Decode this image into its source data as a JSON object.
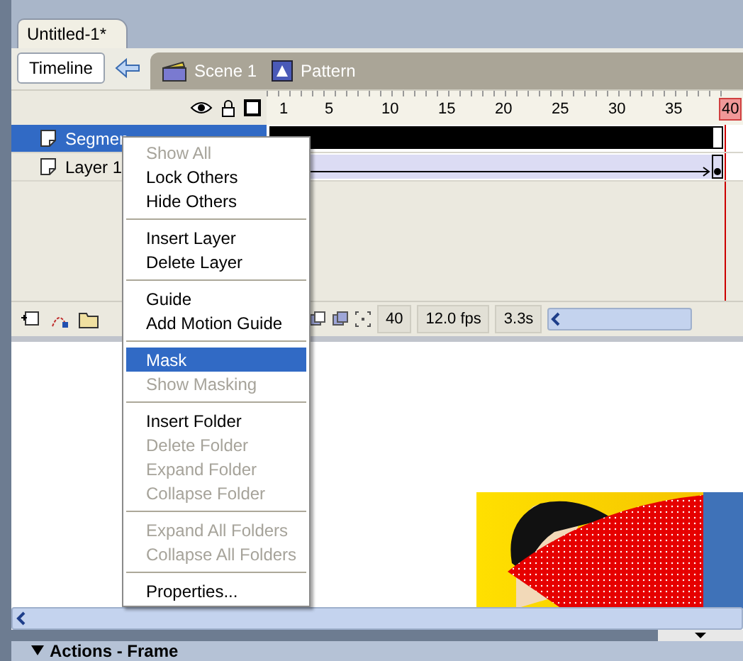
{
  "document_tab": {
    "title": "Untitled-1*",
    "selected": true
  },
  "toolbar": {
    "timeline_button": "Timeline",
    "breadcrumbs": [
      {
        "label": "Scene 1",
        "kind": "scene"
      },
      {
        "label": "Pattern",
        "kind": "symbol"
      }
    ]
  },
  "timeline": {
    "ruler": [
      {
        "label": "1",
        "current": false
      },
      {
        "label": "5",
        "current": false
      },
      {
        "label": "10",
        "current": false
      },
      {
        "label": "15",
        "current": false
      },
      {
        "label": "20",
        "current": false
      },
      {
        "label": "25",
        "current": false
      },
      {
        "label": "30",
        "current": false
      },
      {
        "label": "35",
        "current": false
      },
      {
        "label": "40",
        "current": true
      }
    ],
    "layers": [
      {
        "name": "Segmen",
        "selected": true,
        "kind": "shape"
      },
      {
        "name": "Layer 1",
        "selected": false,
        "kind": "tween"
      }
    ],
    "status": {
      "frame": "40",
      "rate": "12.0 fps",
      "time": "3.3s"
    }
  },
  "context_menu": {
    "groups": [
      [
        {
          "label": "Show All",
          "disabled": true,
          "selected": false
        },
        {
          "label": "Lock Others",
          "disabled": false,
          "selected": false
        },
        {
          "label": "Hide Others",
          "disabled": false,
          "selected": false
        }
      ],
      [
        {
          "label": "Insert Layer",
          "disabled": false,
          "selected": false
        },
        {
          "label": "Delete Layer",
          "disabled": false,
          "selected": false
        }
      ],
      [
        {
          "label": "Guide",
          "disabled": false,
          "selected": false
        },
        {
          "label": "Add Motion Guide",
          "disabled": false,
          "selected": false
        }
      ],
      [
        {
          "label": "Mask",
          "disabled": false,
          "selected": true
        },
        {
          "label": "Show Masking",
          "disabled": true,
          "selected": false
        }
      ],
      [
        {
          "label": "Insert Folder",
          "disabled": false,
          "selected": false
        },
        {
          "label": "Delete Folder",
          "disabled": true,
          "selected": false
        },
        {
          "label": "Expand Folder",
          "disabled": true,
          "selected": false
        },
        {
          "label": "Collapse Folder",
          "disabled": true,
          "selected": false
        }
      ],
      [
        {
          "label": "Expand All Folders",
          "disabled": true,
          "selected": false
        },
        {
          "label": "Collapse All Folders",
          "disabled": true,
          "selected": false
        }
      ],
      [
        {
          "label": "Properties...",
          "disabled": false,
          "selected": false
        }
      ]
    ]
  },
  "panels": [
    {
      "title": "Actions - Frame",
      "expanded": true
    }
  ]
}
